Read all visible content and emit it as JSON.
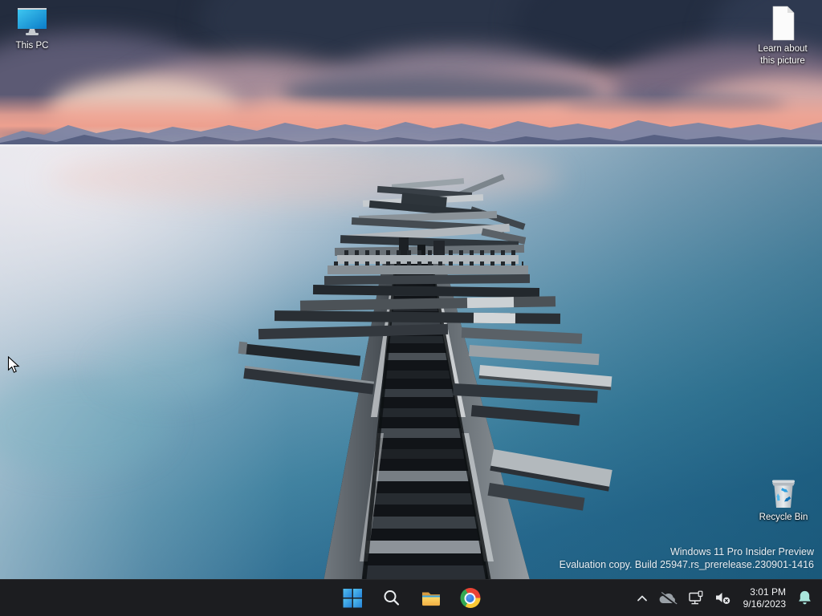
{
  "theme": {
    "colors": {
      "taskbar_bg": "#1c1d20",
      "bell": "#a9e6dc",
      "icon_white": "#e9eaec",
      "label_white": "#ffffff",
      "watermark": "#e9eef3",
      "start_blue_light": "#53c0f0",
      "start_blue_dark": "#2482d8",
      "pc_screen_light": "#3ec6f0",
      "pc_screen_dark": "#0b7cc8",
      "recycle_arrow_blue": "#2f9fe0"
    }
  },
  "wallpaper": {
    "description": "Ruined wooden pier stretching into calm water under a pink and slate sunset sky",
    "colors": {
      "sky_top": "#323c50",
      "cloud_pink": "#c79da3",
      "horizon_glow": "#f0a493",
      "mountains_far": "#7d86a5",
      "mountains_near": "#545e80",
      "water_light": "#dfe3ea",
      "water_deep": "#1f5f82",
      "wood_dark": "#22262b",
      "wood_light": "#c9ced2"
    }
  },
  "desktop": {
    "icons": [
      {
        "id": "this-pc",
        "label": "This PC"
      },
      {
        "id": "learn-about-picture",
        "label": "Learn about this picture"
      },
      {
        "id": "recycle-bin",
        "label": "Recycle Bin"
      }
    ],
    "watermark": {
      "line1": "Windows 11 Pro Insider Preview",
      "line2": "Evaluation copy. Build 25947.rs_prerelease.230901-1416"
    }
  },
  "taskbar": {
    "buttons": [
      {
        "id": "start",
        "label": "Start"
      },
      {
        "id": "search",
        "label": "Search"
      },
      {
        "id": "file-explorer",
        "label": "File Explorer"
      },
      {
        "id": "chrome",
        "label": "Google Chrome"
      }
    ],
    "tray": {
      "hidden_icons_label": "Show hidden icons",
      "onedrive_label": "OneDrive",
      "network_label": "Network",
      "volume_label": "Volume (muted)",
      "notifications_label": "Notifications",
      "clock": {
        "time": "3:01 PM",
        "date": "9/16/2023"
      }
    }
  }
}
